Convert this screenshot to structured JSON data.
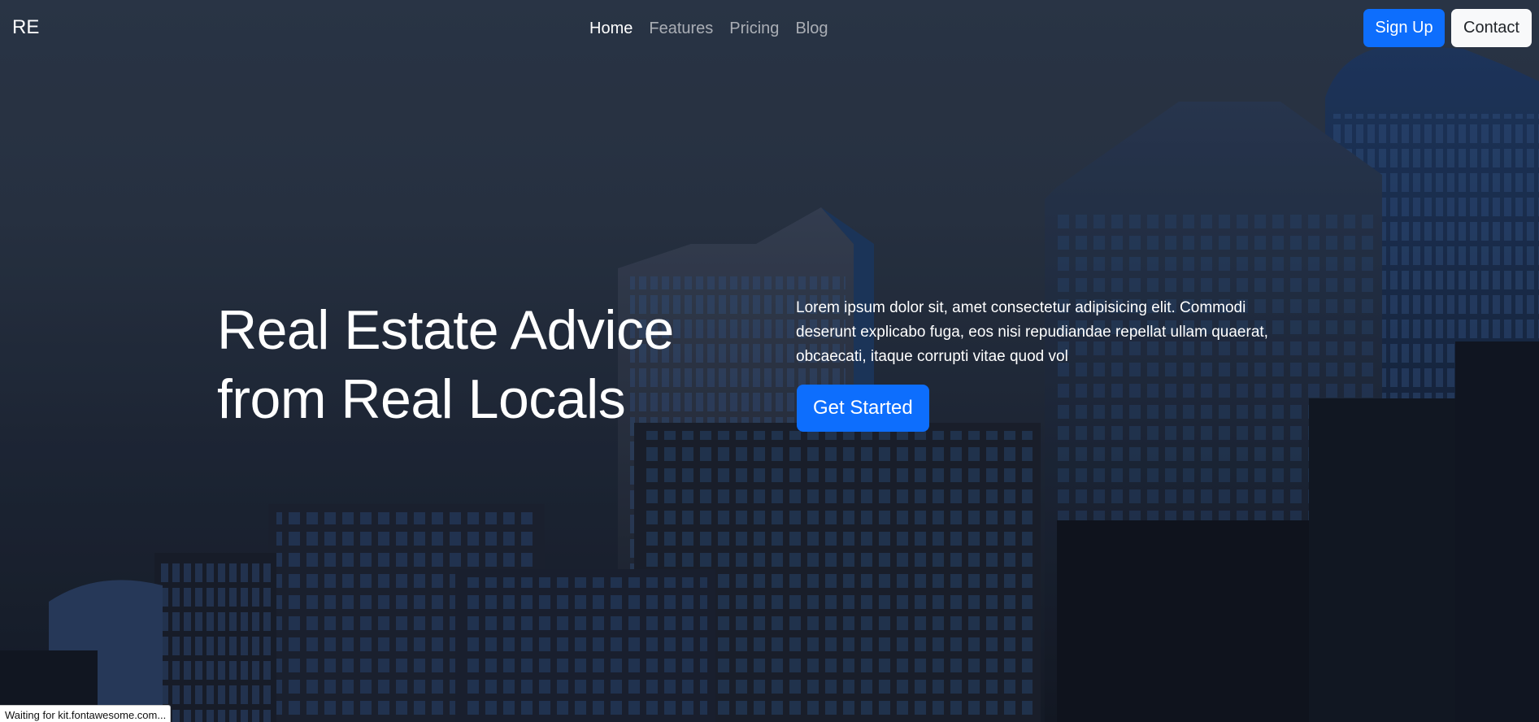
{
  "navbar": {
    "brand": "RE",
    "links": [
      {
        "label": "Home",
        "active": true
      },
      {
        "label": "Features",
        "active": false
      },
      {
        "label": "Pricing",
        "active": false
      },
      {
        "label": "Blog",
        "active": false
      }
    ],
    "signup_label": "Sign Up",
    "contact_label": "Contact"
  },
  "hero": {
    "headline_line1": "Real Estate Advice",
    "headline_line2": "from Real Locals",
    "lede": "Lorem ipsum dolor sit, amet consectetur adipisicing elit. Commodi deserunt explicabo fuga, eos nisi repudiandae repellat ullam quaerat, obcaecati, itaque corrupti vitae quod vol",
    "cta_label": "Get Started",
    "background": "city skyline photo"
  },
  "status_bar": {
    "text": "Waiting for kit.fontawesome.com..."
  },
  "colors": {
    "primary": "#0d6efd",
    "light": "#f8f9fa",
    "overlay": "#2a3546"
  }
}
